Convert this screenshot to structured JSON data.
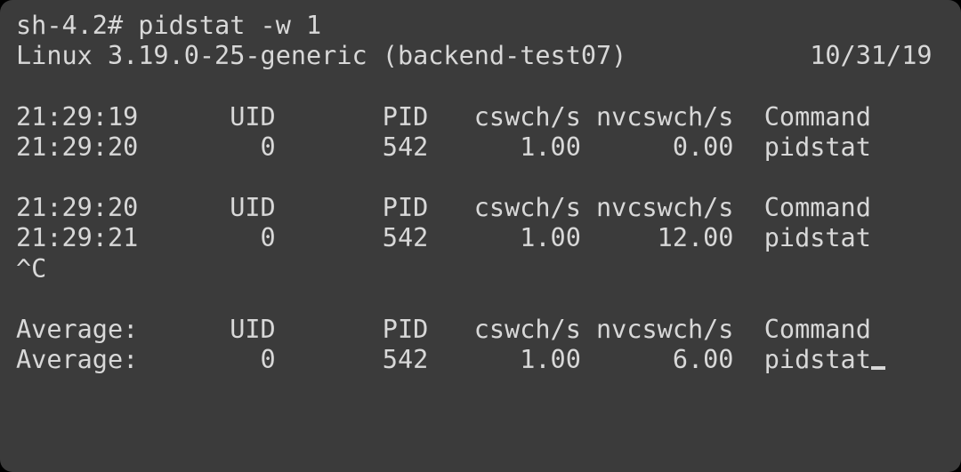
{
  "prompt": "sh-4.2# ",
  "command": "pidstat -w 1",
  "system_line": {
    "os": "Linux 3.19.0-25-generic",
    "host": "(backend-test07)",
    "date": "10/31/19"
  },
  "header_cols": {
    "uid": "UID",
    "pid": "PID",
    "cswch": "cswch/s",
    "nvcswch": "nvcswch/s",
    "command": "Command"
  },
  "samples": [
    {
      "header_time": "21:29:19",
      "rows": [
        {
          "time": "21:29:20",
          "uid": "0",
          "pid": "542",
          "cswch": "1.00",
          "nvcswch": "0.00",
          "command": "pidstat"
        }
      ]
    },
    {
      "header_time": "21:29:20",
      "rows": [
        {
          "time": "21:29:21",
          "uid": "0",
          "pid": "542",
          "cswch": "1.00",
          "nvcswch": "12.00",
          "command": "pidstat"
        }
      ]
    }
  ],
  "interrupt": "^C",
  "average": {
    "label": "Average:",
    "rows": [
      {
        "uid": "0",
        "pid": "542",
        "cswch": "1.00",
        "nvcswch": "6.00",
        "command": "pidstat"
      }
    ]
  }
}
